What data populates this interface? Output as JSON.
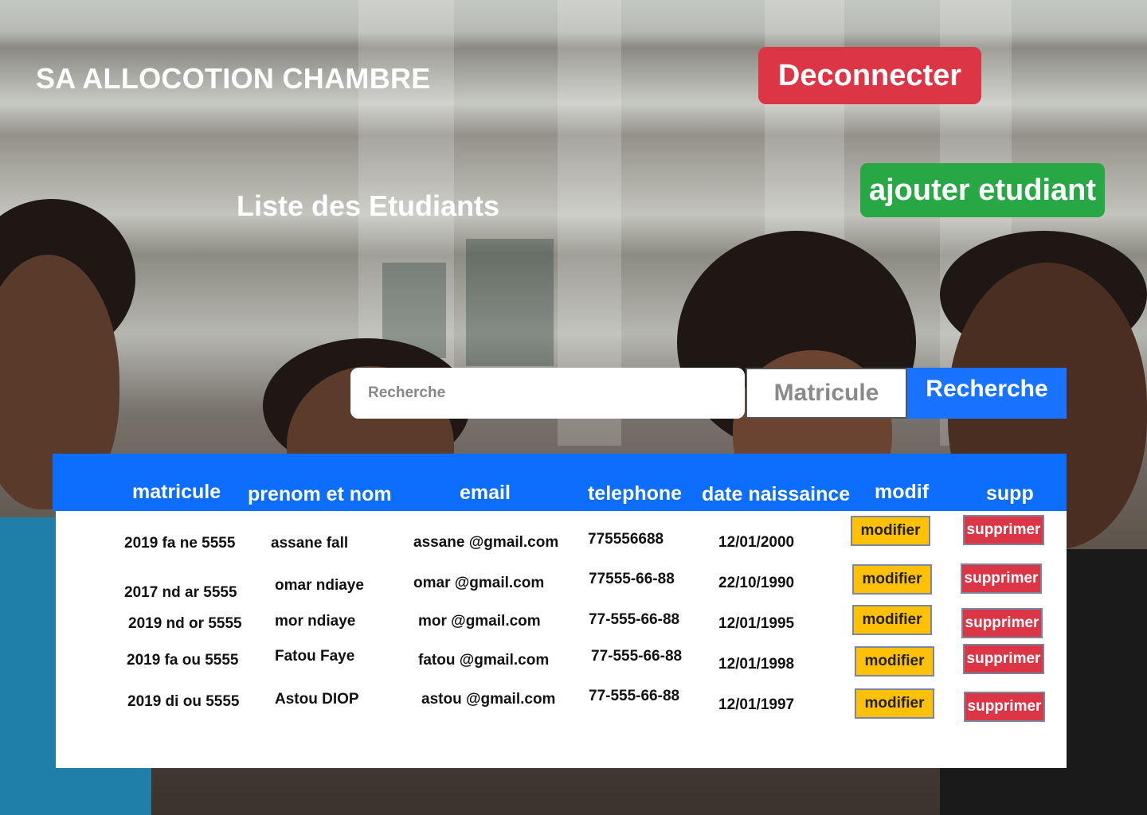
{
  "header": {
    "app_title": "SA ALLOCOTION CHAMBRE",
    "logout_label": "Deconnecter",
    "add_label": "ajouter etudiant",
    "page_title": "Liste des Etudiants"
  },
  "search": {
    "placeholder": "Recherche",
    "filter_value": "Matricule",
    "button_label": "Recherche"
  },
  "table": {
    "columns": [
      "matricule",
      "prenom et nom",
      "email",
      "telephone",
      "date naissaince",
      "modif",
      "supp"
    ],
    "rows": [
      {
        "matricule": "2019 fa ne 5555",
        "nom": "assane fall",
        "email": "assane @gmail.com",
        "telephone": "775556688",
        "date": "12/01/2000",
        "modif": "modifier",
        "supp": "supprimer"
      },
      {
        "matricule": "2017 nd ar  5555",
        "nom": "omar ndiaye",
        "email": "omar @gmail.com",
        "telephone": "77555-66-88",
        "date": "22/10/1990",
        "modif": "modifier",
        "supp": "supprimer"
      },
      {
        "matricule": "2019 nd or 5555",
        "nom": "mor ndiaye",
        "email": "mor @gmail.com",
        "telephone": "77-555-66-88",
        "date": "12/01/1995",
        "modif": "modifier",
        "supp": "supprimer"
      },
      {
        "matricule": "2019 fa ou 5555",
        "nom": "Fatou Faye",
        "email": "fatou @gmail.com",
        "telephone": "77-555-66-88",
        "date": "12/01/1998",
        "modif": "modifier",
        "supp": "supprimer"
      },
      {
        "matricule": "2019  di ou 5555",
        "nom": "Astou DIOP",
        "email": "astou @gmail.com",
        "telephone": "77-555-66-88",
        "date": "12/01/1997",
        "modif": "modifier",
        "supp": "supprimer"
      }
    ]
  },
  "colors": {
    "danger": "#dc3545",
    "success": "#28a745",
    "primary": "#0d6efd",
    "warning": "#ffc107"
  }
}
